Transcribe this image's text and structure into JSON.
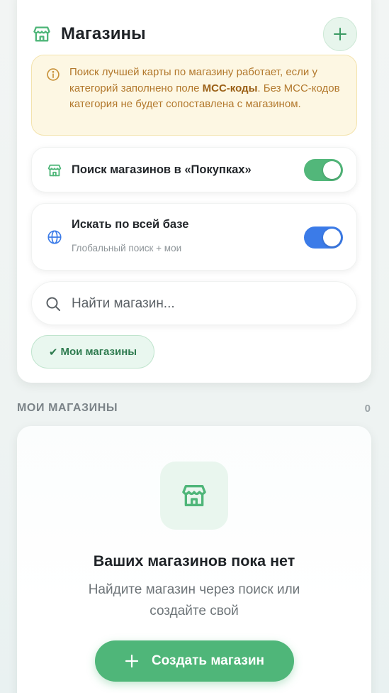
{
  "header": {
    "title": "Магазины",
    "icon": "store-icon",
    "add_button_icon": "plus-icon"
  },
  "notice": {
    "icon": "info-icon",
    "text_before": "Поиск лучшей карты по магазину работает, если у категорий заполнено поле ",
    "text_bold": "MCC-коды",
    "text_after": ". Без MCC-кодов категория не будет сопоставлена с магазином."
  },
  "settings": {
    "purchases_search": {
      "label": "Поиск магазинов в «Покупках»",
      "icon": "store-icon",
      "enabled": true
    },
    "global_search": {
      "label": "Искать по всей базе",
      "subtitle": "Глобальный поиск + мои",
      "icon": "globe-icon",
      "enabled": true
    }
  },
  "search": {
    "placeholder": "Найти магазин..."
  },
  "filter_chip": {
    "check": "✔",
    "label": "Мои магазины"
  },
  "my_stores": {
    "section_title": "МОИ МАГАЗИНЫ",
    "count": "0",
    "empty_title": "Ваших магазинов пока нет",
    "empty_description": "Найдите магазин через поиск или создайте свой",
    "create_button": "Создать магазин"
  },
  "colors": {
    "accent_green": "#4fb679",
    "toggle_blue": "#3b7be8",
    "notice_bg": "#fdf7e3",
    "notice_text": "#b2782c"
  }
}
